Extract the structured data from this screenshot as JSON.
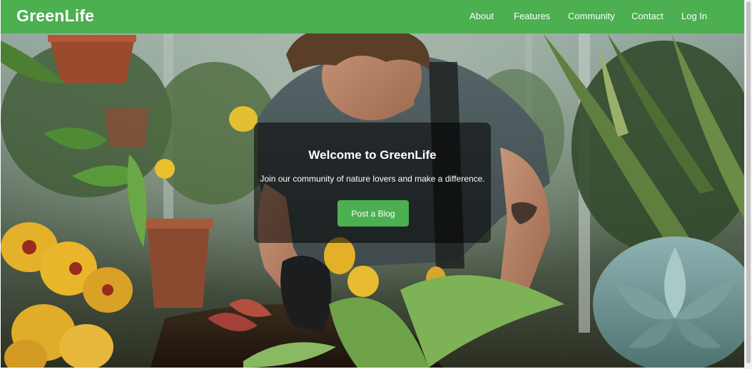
{
  "brand": "GreenLife",
  "nav": {
    "items": [
      {
        "label": "About"
      },
      {
        "label": "Features"
      },
      {
        "label": "Community"
      },
      {
        "label": "Contact"
      },
      {
        "label": "Log In"
      }
    ]
  },
  "hero": {
    "title": "Welcome to GreenLife",
    "subtitle": "Join our community of nature lovers and make a difference.",
    "cta_label": "Post a Blog",
    "image": "hero-gardener-photo"
  },
  "colors": {
    "primary": "#4caf50",
    "text_on_primary": "#ffffff",
    "overlay": "rgba(0,0,0,0.55)"
  }
}
